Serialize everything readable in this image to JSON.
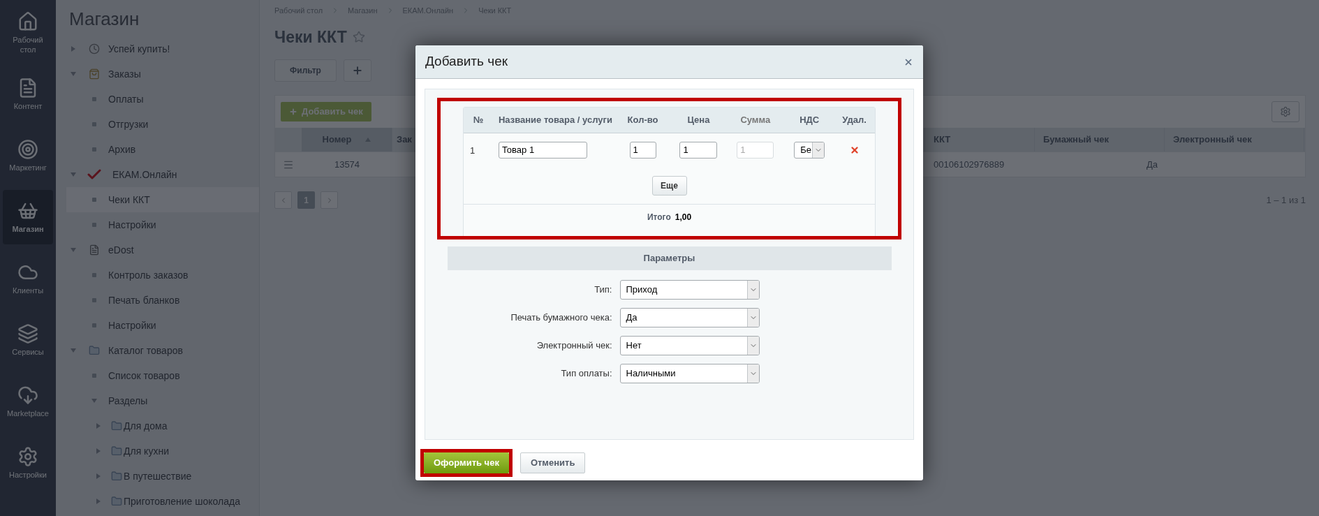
{
  "rail": [
    {
      "label": "Рабочий стол",
      "selected": false
    },
    {
      "label": "Контент",
      "selected": false
    },
    {
      "label": "Маркетинг",
      "selected": false
    },
    {
      "label": "Магазин",
      "selected": true
    },
    {
      "label": "Клиенты",
      "selected": false
    },
    {
      "label": "Сервисы",
      "selected": false
    },
    {
      "label": "Marketplace",
      "selected": false
    },
    {
      "label": "Настройки",
      "selected": false
    }
  ],
  "sidebar": {
    "title": "Магазин",
    "items": [
      {
        "label": "Успей купить!",
        "expanded": false
      },
      {
        "label": "Заказы",
        "expanded": true,
        "children": [
          {
            "label": "Оплаты",
            "selected": false
          },
          {
            "label": "Отгрузки",
            "selected": false
          },
          {
            "label": "Архив",
            "selected": false
          }
        ]
      },
      {
        "label": "ЕКАМ.Онлайн",
        "expanded": true,
        "children": [
          {
            "label": "Чеки ККТ",
            "selected": true
          },
          {
            "label": "Настройки",
            "selected": false
          }
        ]
      },
      {
        "label": "eDost",
        "expanded": true,
        "children": [
          {
            "label": "Контроль заказов",
            "selected": false
          },
          {
            "label": "Печать бланков",
            "selected": false
          },
          {
            "label": "Настройки",
            "selected": false
          }
        ]
      },
      {
        "label": "Каталог товаров",
        "expanded": true,
        "children": [
          {
            "label": "Список товаров",
            "selected": false
          },
          {
            "label": "Разделы",
            "expanded": true,
            "children": [
              {
                "label": "Для дома",
                "expanded": false
              },
              {
                "label": "Для кухни",
                "expanded": false
              },
              {
                "label": "В путешествие",
                "expanded": false
              },
              {
                "label": "Приготовление шоколада",
                "expanded": false
              }
            ]
          }
        ]
      }
    ]
  },
  "breadcrumbs": [
    "Рабочий стол",
    "Магазин",
    "ЕКАМ.Онлайн",
    "Чеки ККТ"
  ],
  "page_title": "Чеки ККТ",
  "filter_button": "Фильтр",
  "add_button": "Добавить чек",
  "table": {
    "columns": [
      {
        "label": "Номер",
        "sorted": true
      },
      {
        "label": "Зак"
      },
      {
        "label": "ККТ",
        "sorted": false
      },
      {
        "label": "Бумажный чек",
        "sorted": false
      },
      {
        "label": "Электронный чек",
        "sorted": false
      }
    ],
    "rows": [
      {
        "number": "13574",
        "kkt": "00106102976889",
        "paper": "Да"
      }
    ]
  },
  "pagination": {
    "pages": [
      {
        "label": "1",
        "selected": true
      }
    ],
    "summary": "1 – 1 из 1"
  },
  "dialog": {
    "title": "Добавить чек",
    "items": {
      "highlighted": true,
      "columns": [
        "№",
        "Название товара / услуги",
        "Кол-во",
        "Цена",
        "Сумма",
        "НДС",
        "Удал."
      ],
      "rows": [
        {
          "n": "1",
          "name": "Товар 1",
          "qty": "1",
          "price": "1",
          "sum": "1",
          "sum_disabled": true,
          "vat": "Бе"
        }
      ],
      "more_button": "Еще",
      "total_label": "Итого",
      "total_value": "1,00"
    },
    "params_title": "Параметры",
    "params": [
      {
        "label": "Тип:",
        "value": "Приход"
      },
      {
        "label": "Печать бумажного чека:",
        "value": "Да"
      },
      {
        "label": "Электронный чек:",
        "value": "Нет"
      },
      {
        "label": "Тип оплаты:",
        "value": "Наличными"
      }
    ],
    "buttons": [
      {
        "label": "Оформить чек",
        "kind": "primary",
        "highlighted": true
      },
      {
        "label": "Отменить",
        "kind": "secondary",
        "highlighted": false
      }
    ]
  }
}
